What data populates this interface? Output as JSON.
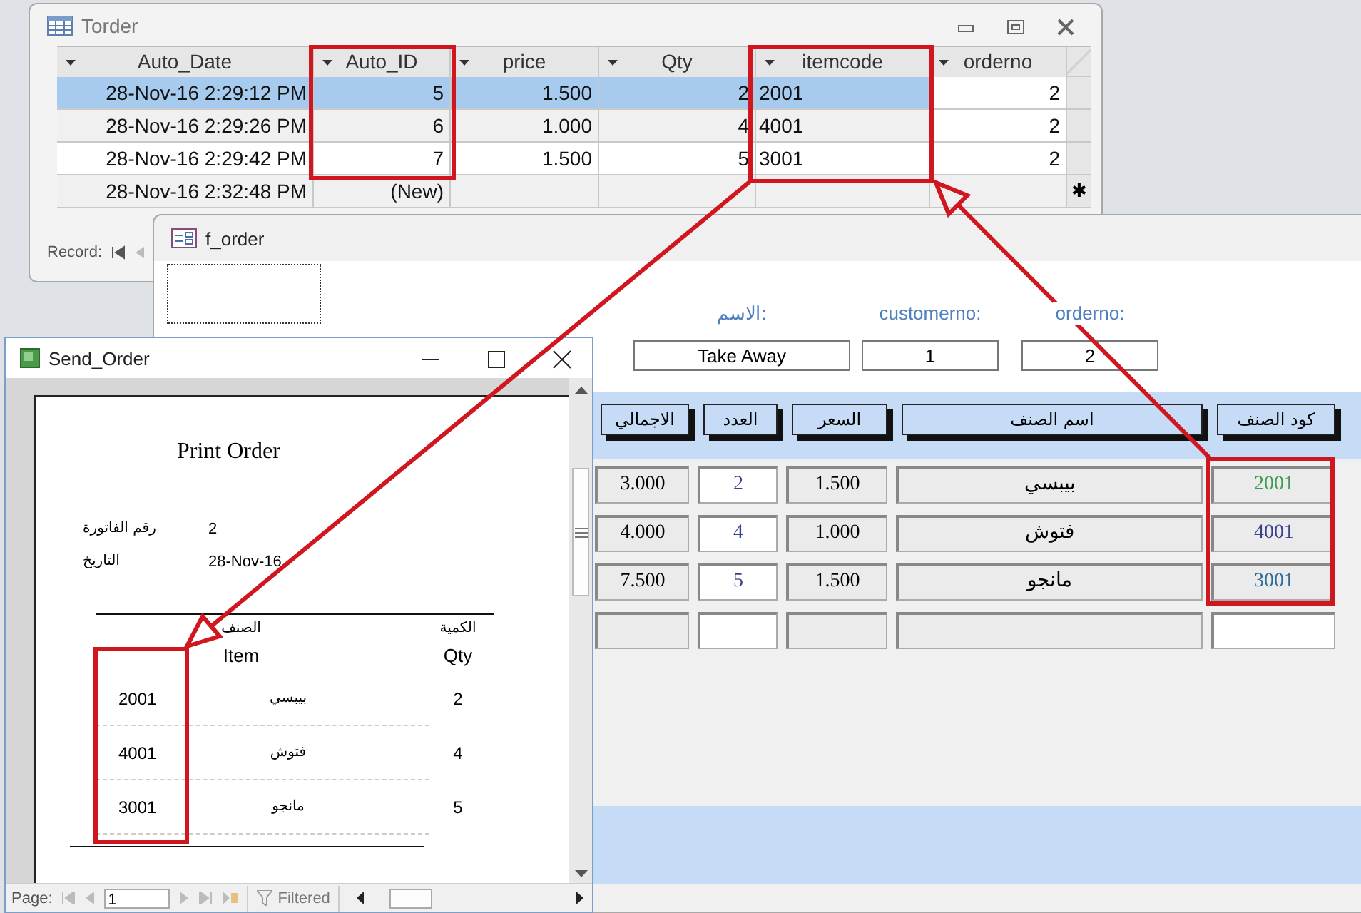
{
  "torder": {
    "title": "Torder",
    "columns": [
      "Auto_Date",
      "Auto_ID",
      "price",
      "Qty",
      "itemcode",
      "orderno"
    ],
    "rows": [
      {
        "cells": [
          "28-Nov-16 2:29:12 PM",
          "5",
          "1.500",
          "2",
          "2001",
          "2"
        ],
        "selected": true
      },
      {
        "cells": [
          "28-Nov-16 2:29:26 PM",
          "6",
          "1.000",
          "4",
          "4001",
          "2"
        ],
        "selected": false
      },
      {
        "cells": [
          "28-Nov-16 2:29:42 PM",
          "7",
          "1.500",
          "5",
          "3001",
          "2"
        ],
        "selected": false
      }
    ],
    "new_row": {
      "auto_date": "28-Nov-16 2:32:48 PM",
      "auto_id": "(New)",
      "marker": "✱"
    },
    "record_label": "Record:"
  },
  "f_order": {
    "title": "f_order",
    "fields": [
      {
        "label": "الاسم:",
        "value": "Take Away"
      },
      {
        "label": "customerno:",
        "value": "1"
      },
      {
        "label": "orderno:",
        "value": "2"
      }
    ],
    "headers": [
      "كود الصنف",
      "اسم الصنف",
      "السعر",
      "العدد",
      "الاجمالي"
    ],
    "rows": [
      {
        "total": "3.000",
        "qty": "2",
        "price": "1.500",
        "name": "بيبسي",
        "code": "2001",
        "color": "#3d9a52"
      },
      {
        "total": "4.000",
        "qty": "4",
        "price": "1.000",
        "name": "فتوش",
        "code": "4001",
        "color": "#3b3f8f"
      },
      {
        "total": "7.500",
        "qty": "5",
        "price": "1.500",
        "name": "مانجو",
        "code": "3001",
        "color": "#2a6a9a"
      }
    ]
  },
  "send_order": {
    "title": "Send_Order",
    "report": {
      "title": "Print Order",
      "fields": [
        {
          "label": "رقم الفاتورة",
          "value": "2"
        },
        {
          "label": "التاريخ",
          "value": "28-Nov-16"
        }
      ],
      "columns_ar": [
        "الكمية",
        "الصنف"
      ],
      "columns_en": [
        "Item",
        "Qty"
      ],
      "items": [
        {
          "code": "2001",
          "name": "بيبسي",
          "qty": "2"
        },
        {
          "code": "4001",
          "name": "فتوش",
          "qty": "4"
        },
        {
          "code": "3001",
          "name": "مانجو",
          "qty": "5"
        }
      ]
    },
    "page_label": "Page:",
    "page": "1",
    "filter": "Filtered"
  }
}
